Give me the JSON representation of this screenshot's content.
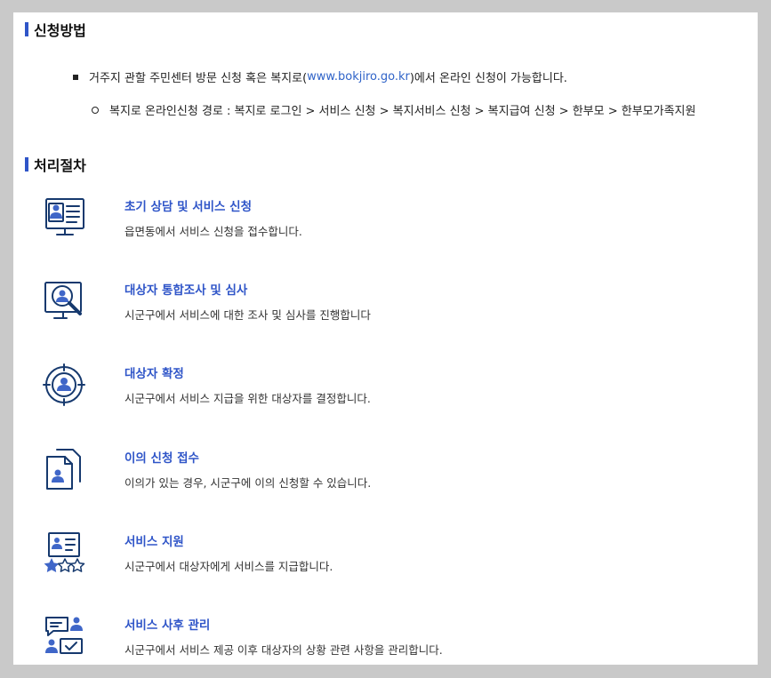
{
  "sections": {
    "apply_method": {
      "title": "신청방법",
      "bullet1": {
        "prefix": "거주지 관할 주민센터 방문 신청 혹은 복지로(",
        "link": "www.bokjiro.go.kr",
        "suffix": ")에서 온라인 신청이 가능합니다."
      },
      "bullet2": "복지로 온라인신청 경로 : 복지로 로그인 > 서비스 신청 > 복지서비스 신청 > 복지급여 신청 > 한부모 > 한부모가족지원"
    },
    "procedure": {
      "title": "처리절차",
      "steps": [
        {
          "icon": "monitor-user-icon",
          "title": "초기 상담 및 서비스 신청",
          "desc": "읍면동에서 서비스 신청을 접수합니다."
        },
        {
          "icon": "magnifier-user-icon",
          "title": "대상자 통합조사 및 심사",
          "desc": "시군구에서 서비스에 대한 조사 및 심사를 진행합니다"
        },
        {
          "icon": "target-user-icon",
          "title": "대상자 확정",
          "desc": "시군구에서 서비스 지급을 위한 대상자를 결정합니다."
        },
        {
          "icon": "document-user-icon",
          "title": "이의 신청 접수",
          "desc": "이의가 있는 경우, 시군구에 이의 신청할 수 있습니다."
        },
        {
          "icon": "user-card-stars-icon",
          "title": "서비스 지원",
          "desc": "시군구에서 대상자에게 서비스를 지급합니다."
        },
        {
          "icon": "chat-check-users-icon",
          "title": "서비스 사후 관리",
          "desc": "시군구에서 서비스 제공 이후 대상자의 상황 관련 사항을 관리합니다."
        }
      ]
    }
  },
  "colors": {
    "accent": "#2f55c8",
    "link": "#2f63c8",
    "icon_dark": "#16396e",
    "icon_blue": "#3f66c8"
  }
}
